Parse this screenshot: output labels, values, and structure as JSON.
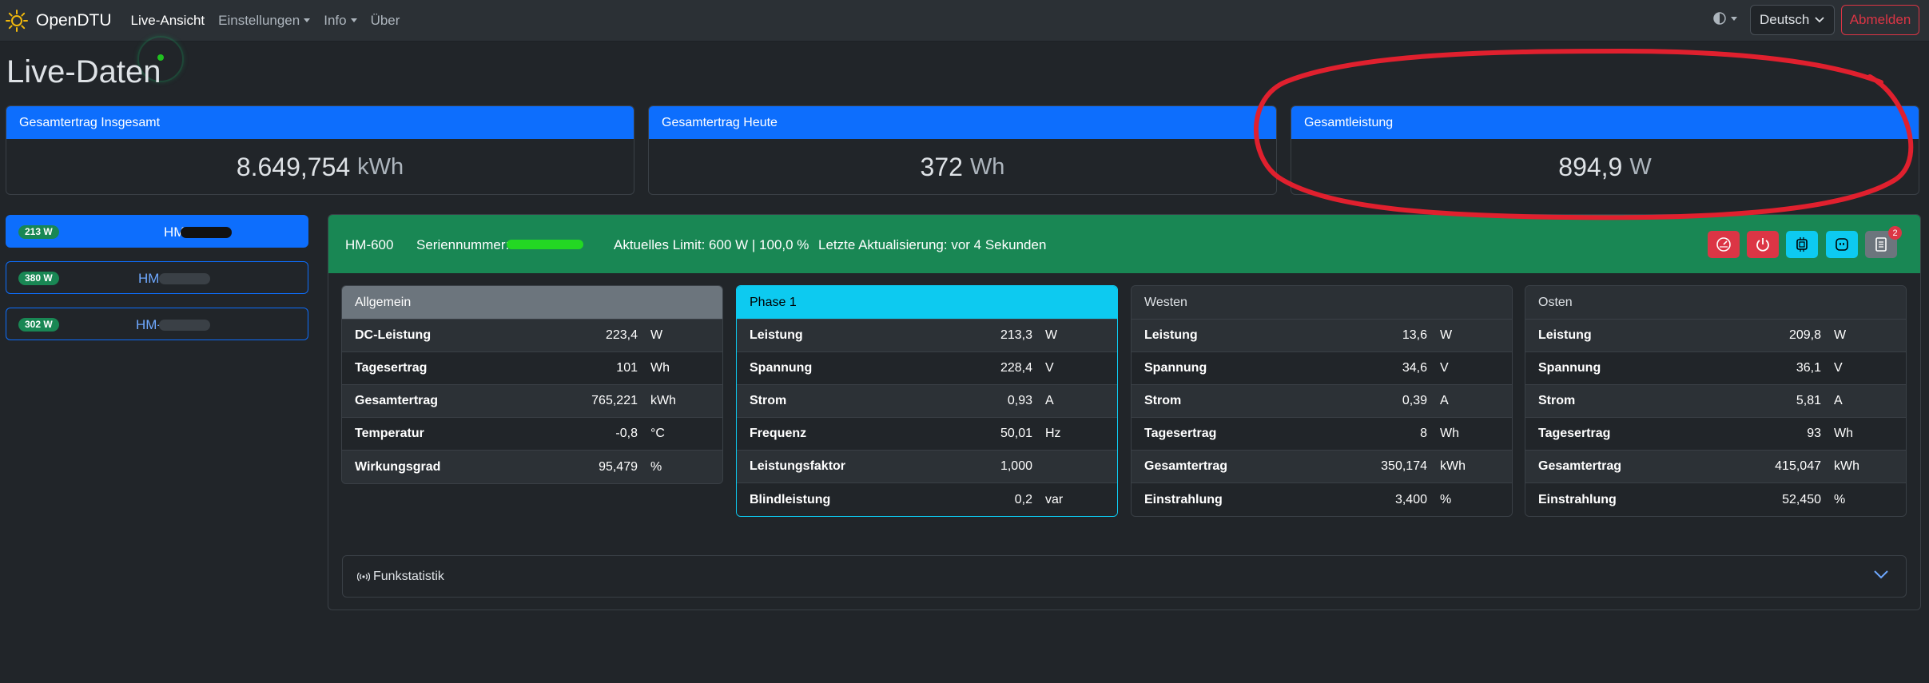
{
  "nav": {
    "brand": "OpenDTU",
    "live": "Live-Ansicht",
    "settings": "Einstellungen",
    "info": "Info",
    "about": "Über",
    "language": "Deutsch",
    "logout": "Abmelden"
  },
  "page_title": "Live-Daten",
  "summary": [
    {
      "label": "Gesamtertrag Insgesamt",
      "value": "8.649,754",
      "unit": "kWh"
    },
    {
      "label": "Gesamtertrag Heute",
      "value": "372",
      "unit": "Wh"
    },
    {
      "label": "Gesamtleistung",
      "value": "894,9",
      "unit": "W"
    }
  ],
  "inverters": [
    {
      "power": "213 W",
      "name": "HM-"
    },
    {
      "power": "380 W",
      "name": "HM-"
    },
    {
      "power": "302 W",
      "name": "HM-"
    }
  ],
  "detail": {
    "model": "HM-600",
    "serial_label": "Seriennummer:",
    "limit": "Aktuelles Limit: 600 W | 100,0 %",
    "update": "Letzte Aktualisierung: vor 4 Sekunden",
    "notification_count": "2"
  },
  "tables": [
    {
      "title": "Allgemein",
      "rows": [
        {
          "label": "DC-Leistung",
          "value": "223,4",
          "unit": "W"
        },
        {
          "label": "Tagesertrag",
          "value": "101",
          "unit": "Wh"
        },
        {
          "label": "Gesamtertrag",
          "value": "765,221",
          "unit": "kWh"
        },
        {
          "label": "Temperatur",
          "value": "-0,8",
          "unit": "°C"
        },
        {
          "label": "Wirkungsgrad",
          "value": "95,479",
          "unit": "%"
        }
      ]
    },
    {
      "title": "Phase 1",
      "rows": [
        {
          "label": "Leistung",
          "value": "213,3",
          "unit": "W"
        },
        {
          "label": "Spannung",
          "value": "228,4",
          "unit": "V"
        },
        {
          "label": "Strom",
          "value": "0,93",
          "unit": "A"
        },
        {
          "label": "Frequenz",
          "value": "50,01",
          "unit": "Hz"
        },
        {
          "label": "Leistungsfaktor",
          "value": "1,000",
          "unit": ""
        },
        {
          "label": "Blindleistung",
          "value": "0,2",
          "unit": "var"
        }
      ]
    },
    {
      "title": "Westen",
      "rows": [
        {
          "label": "Leistung",
          "value": "13,6",
          "unit": "W"
        },
        {
          "label": "Spannung",
          "value": "34,6",
          "unit": "V"
        },
        {
          "label": "Strom",
          "value": "0,39",
          "unit": "A"
        },
        {
          "label": "Tagesertrag",
          "value": "8",
          "unit": "Wh"
        },
        {
          "label": "Gesamtertrag",
          "value": "350,174",
          "unit": "kWh"
        },
        {
          "label": "Einstrahlung",
          "value": "3,400",
          "unit": "%"
        }
      ]
    },
    {
      "title": "Osten",
      "rows": [
        {
          "label": "Leistung",
          "value": "209,8",
          "unit": "W"
        },
        {
          "label": "Spannung",
          "value": "36,1",
          "unit": "V"
        },
        {
          "label": "Strom",
          "value": "5,81",
          "unit": "A"
        },
        {
          "label": "Tagesertrag",
          "value": "93",
          "unit": "Wh"
        },
        {
          "label": "Gesamtertrag",
          "value": "415,047",
          "unit": "kWh"
        },
        {
          "label": "Einstrahlung",
          "value": "52,450",
          "unit": "%"
        }
      ]
    }
  ],
  "radio_stats": "Funkstatistik",
  "colors": {
    "primary": "#0d6efd",
    "success": "#198754",
    "danger": "#dc3545",
    "info": "#0dcaf0",
    "annotation": "#e0202e"
  }
}
